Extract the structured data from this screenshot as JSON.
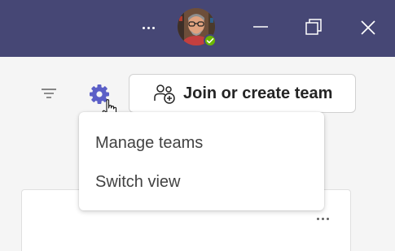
{
  "titlebar": {
    "background": "#464775",
    "icons": {
      "more": "more-horizontal-icon",
      "minimize": "minimize-icon",
      "restore": "restore-icon",
      "close": "close-icon"
    },
    "presence_status_color": "#6bb700"
  },
  "toolbar": {
    "filter_icon": "filter-icon",
    "settings_icon": "gear-icon",
    "settings_color": "#5b5fc7",
    "join_button": {
      "label": "Join or create team",
      "icon": "people-add-icon"
    }
  },
  "settings_menu": {
    "items": [
      {
        "label": "Manage teams"
      },
      {
        "label": "Switch view"
      }
    ]
  },
  "team_card": {
    "more_icon": "more-horizontal-icon"
  }
}
